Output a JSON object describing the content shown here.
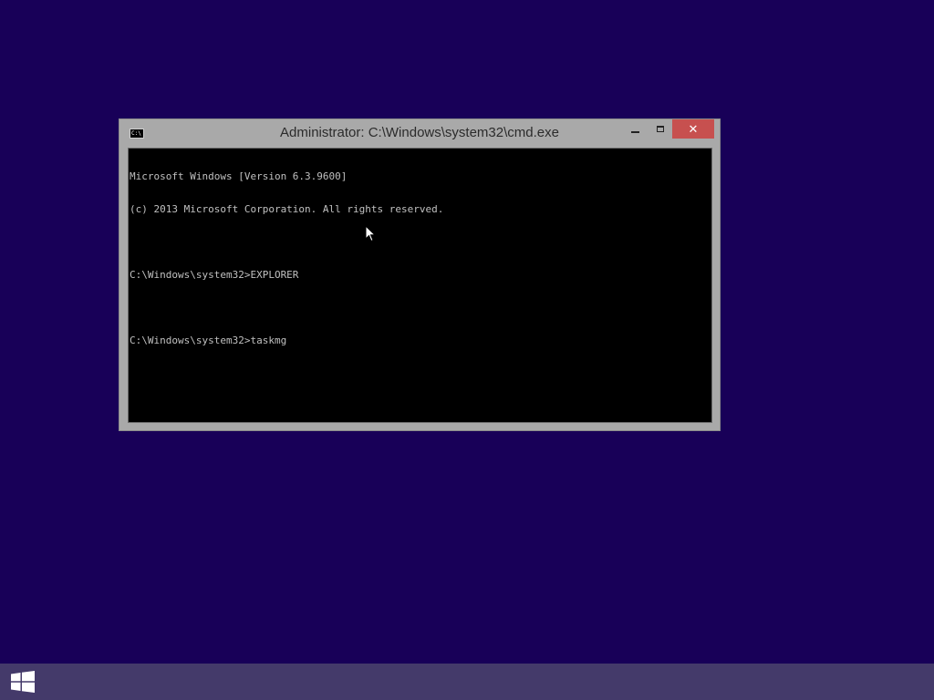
{
  "window": {
    "title": "Administrator: C:\\Windows\\system32\\cmd.exe",
    "icon": "cmd-icon",
    "icon_text": "C:\\",
    "close_label": "✕"
  },
  "console": {
    "lines": [
      "Microsoft Windows [Version 6.3.9600]",
      "(c) 2013 Microsoft Corporation. All rights reserved.",
      "",
      "C:\\Windows\\system32>EXPLORER",
      "",
      "C:\\Windows\\system32>taskmg"
    ]
  },
  "taskbar": {
    "start_icon": "windows-logo-icon"
  },
  "colors": {
    "desktop": "#180058",
    "taskbar": "#443a6a",
    "window_frame": "#a9a9a9",
    "close_button": "#c7504f",
    "console_bg": "#000000",
    "console_text": "#c0c0c0"
  }
}
